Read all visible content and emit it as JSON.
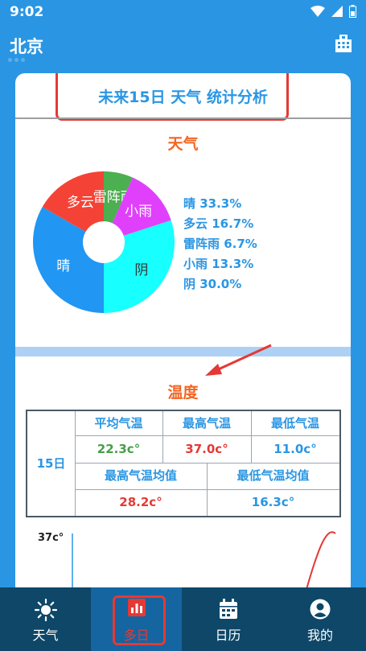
{
  "status": {
    "time": "9:02"
  },
  "app": {
    "city": "北京"
  },
  "card": {
    "title": "未来15日 天气 统计分析",
    "weather_title": "天气",
    "temp_title": "温度"
  },
  "chart_data": {
    "type": "pie",
    "categories": [
      "晴",
      "多云",
      "雷阵雨",
      "小雨",
      "阴"
    ],
    "values": [
      33.3,
      16.7,
      6.7,
      13.3,
      30.0
    ],
    "colors": [
      "#2196f3",
      "#f44336",
      "#4caf50",
      "#e040fb",
      "#18ffff"
    ],
    "legend": [
      "晴 33.3%",
      "多云 16.7%",
      "雷阵雨 6.7%",
      "小雨 13.3%",
      "阴 30.0%"
    ],
    "donut": true
  },
  "temp_table": {
    "days_label": "15日",
    "avg_label": "平均气温",
    "avg_value": "22.3c°",
    "max_label": "最高气温",
    "max_value": "37.0c°",
    "min_label": "最低气温",
    "min_value": "11.0c°",
    "max_avg_label": "最高气温均值",
    "max_avg_value": "28.2c°",
    "min_avg_label": "最低气温均值",
    "min_avg_value": "16.3c°",
    "colors": {
      "avg": "#43a047",
      "max": "#e53935",
      "min": "#2a96e3",
      "label": "#2a96e3",
      "border": "#4a5a68"
    }
  },
  "temp_chart": {
    "y_label": "37c°"
  },
  "nav": [
    {
      "label": "天气",
      "icon": "sun-icon"
    },
    {
      "label": "多日",
      "icon": "bar-chart-icon"
    },
    {
      "label": "日历",
      "icon": "calendar-icon"
    },
    {
      "label": "我的",
      "icon": "account-icon"
    }
  ]
}
